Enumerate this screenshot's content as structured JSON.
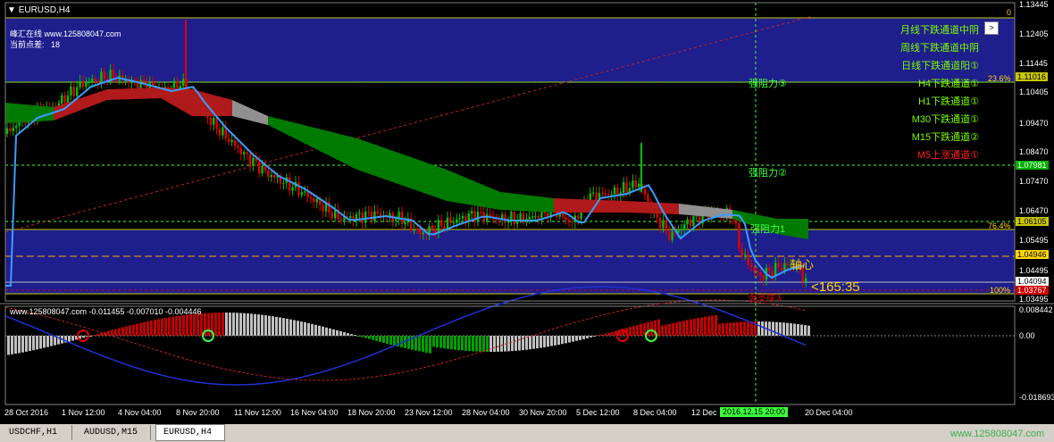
{
  "window": {
    "title": "EURUSD,H4"
  },
  "info": {
    "line1": "峰汇在线 www.125808047.com",
    "line2_label": "当前点差:",
    "line2_value": "18"
  },
  "right_panel": [
    {
      "text": "月线下跌通道中阴",
      "color": "#7cfc00"
    },
    {
      "text": "周线下跌通道中阴",
      "color": "#7cfc00"
    },
    {
      "text": "日线下跌通道阳①",
      "color": "#7cfc00"
    },
    {
      "text": "H4下跌通道①",
      "color": "#7cfc00"
    },
    {
      "text": "H1下跌通道①",
      "color": "#7cfc00"
    },
    {
      "text": "M30下跌通道①",
      "color": "#7cfc00"
    },
    {
      "text": "M15下跌通道②",
      "color": "#7cfc00"
    },
    {
      "text": "M5上涨通道①",
      "color": "#ff2020"
    }
  ],
  "fib": {
    "zero": "0",
    "f236": "23.6%",
    "f764": "76.4%",
    "f100": "100%"
  },
  "annotations": {
    "res3": "强阻力③",
    "res2": "强阻力②",
    "res1": "强阻力1",
    "pivot": "轴心",
    "support": "强支撑①",
    "countdown": "<165:35"
  },
  "price_axis": [
    "1.13445",
    "1.12405",
    "1.11445",
    "1.10405",
    "1.09470",
    "1.08470",
    "1.07470",
    "1.06470",
    "1.05495",
    "1.04495",
    "1.03495"
  ],
  "price_labels": [
    {
      "text": "1.11016",
      "bg": "#c8c800"
    },
    {
      "text": "1.07981",
      "bg": "#00b000"
    },
    {
      "text": "1.06105",
      "bg": "#c8c800"
    },
    {
      "text": "1.04946",
      "bg": "#ffd700"
    },
    {
      "text": "1.04094",
      "bg": "#ffffff"
    },
    {
      "text": "1.03767",
      "bg": "#d00000"
    }
  ],
  "indicator": {
    "title": "www.125808047.com -0.011455 -0.007010 -0.004446",
    "axis_top": "0.008442",
    "axis_mid": "0.00",
    "axis_bottom": "-0.018693"
  },
  "time_axis": [
    "28 Oct 2016",
    "1 Nov 12:00",
    "4 Nov 04:00",
    "8 Nov 20:00",
    "11 Nov 12:00",
    "16 Nov 04:00",
    "18 Nov 20:00",
    "23 Nov 12:00",
    "28 Nov 04:00",
    "30 Nov 20:00",
    "5 Dec 12:00",
    "8 Dec 04:00",
    "12 Dec",
    "20 Dec 04:00"
  ],
  "time_cursor": "2016.12.15 20:00",
  "tabs": [
    {
      "label": "USDCHF,H1",
      "active": false
    },
    {
      "label": "AUDUSD,M15",
      "active": false
    },
    {
      "label": "EURUSD,H4",
      "active": true
    }
  ],
  "footer": {
    "site": "www.125808047.com"
  },
  "colors": {
    "bg": "#000000",
    "band": "#1e1e8c",
    "bull": "#00c000",
    "bear": "#e00000",
    "ma": "#3c9cff",
    "green_line": "#3cff3c"
  }
}
